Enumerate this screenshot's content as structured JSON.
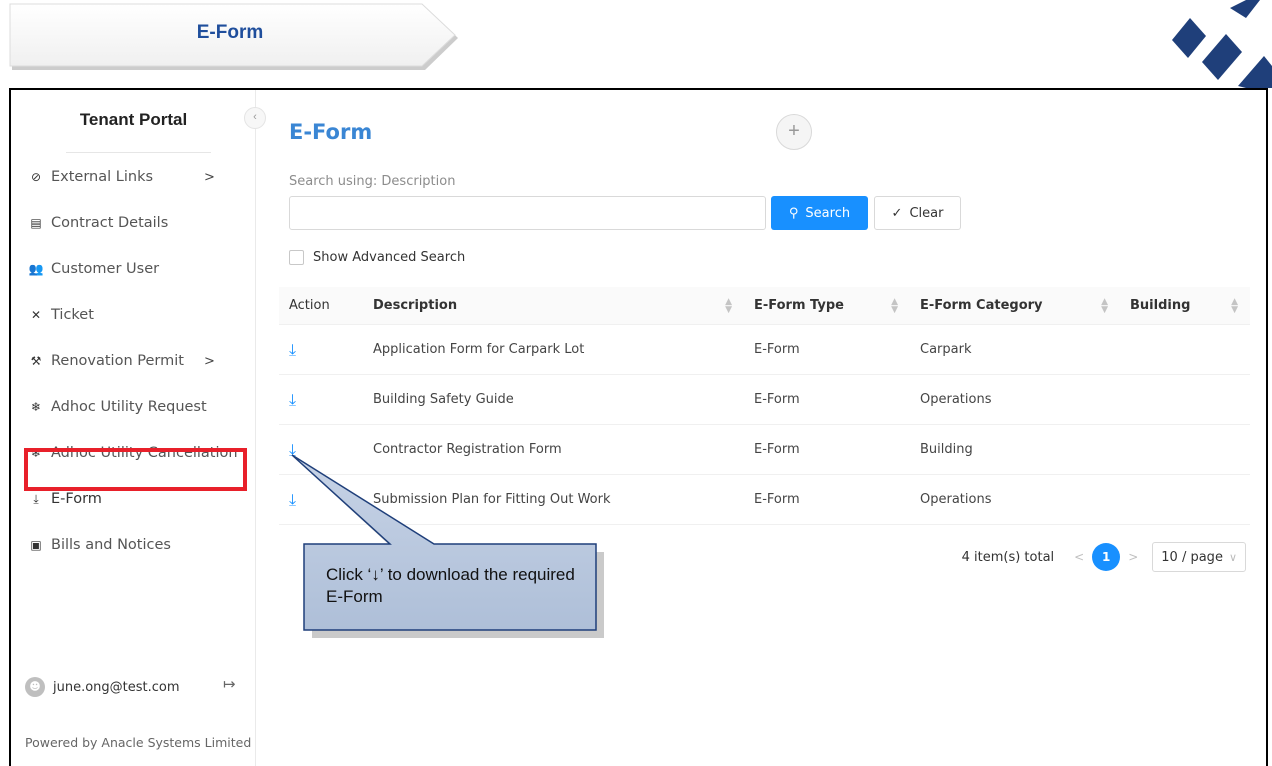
{
  "banner": {
    "title": "E-Form"
  },
  "sidebar": {
    "brand": "Tenant Portal",
    "collapse_icon": "‹",
    "items": [
      {
        "icon": "⊘",
        "label": "External Links",
        "has_submenu": true
      },
      {
        "icon": "▤",
        "label": "Contract Details",
        "has_submenu": false
      },
      {
        "icon": "👥",
        "label": "Customer User",
        "has_submenu": false
      },
      {
        "icon": "✕",
        "label": "Ticket",
        "has_submenu": false
      },
      {
        "icon": "⚒",
        "label": "Renovation Permit",
        "has_submenu": true
      },
      {
        "icon": "❄",
        "label": "Adhoc Utility Request",
        "has_submenu": false
      },
      {
        "icon": "❄",
        "label": "Adhoc Utility Cancellation",
        "has_submenu": false
      },
      {
        "icon": "⤓",
        "label": "E-Form",
        "has_submenu": false
      },
      {
        "icon": "▣",
        "label": "Bills and Notices",
        "has_submenu": false
      }
    ],
    "user_email": "june.ong@test.com",
    "powered_by": "Powered by Anacle Systems Limited"
  },
  "main": {
    "title": "E-Form",
    "search_label": "Search using: Description",
    "search_value": "",
    "search_button": "Search",
    "clear_button": "Clear",
    "advanced_label": "Show Advanced Search",
    "columns": {
      "action": "Action",
      "description": "Description",
      "type": "E-Form Type",
      "category": "E-Form Category",
      "building": "Building"
    },
    "rows": [
      {
        "description": "Application Form for Carpark Lot",
        "type": "E-Form",
        "category": "Carpark",
        "building": ""
      },
      {
        "description": "Building Safety Guide",
        "type": "E-Form",
        "category": "Operations",
        "building": ""
      },
      {
        "description": "Contractor Registration Form",
        "type": "E-Form",
        "category": "Building",
        "building": ""
      },
      {
        "description": "Submission Plan for Fitting Out Work",
        "type": "E-Form",
        "category": "Operations",
        "building": ""
      }
    ],
    "pagination": {
      "total": "4 item(s) total",
      "current_page": "1",
      "page_size": "10 / page"
    }
  },
  "callout": {
    "text": "Click ‘↓’ to download the required E-Form"
  },
  "colors": {
    "accent": "#1890ff",
    "title_blue": "#3a86d4",
    "highlight_red": "#e8202a",
    "callout_fill": "#b8c6dc",
    "callout_border": "#1f3f7a"
  }
}
